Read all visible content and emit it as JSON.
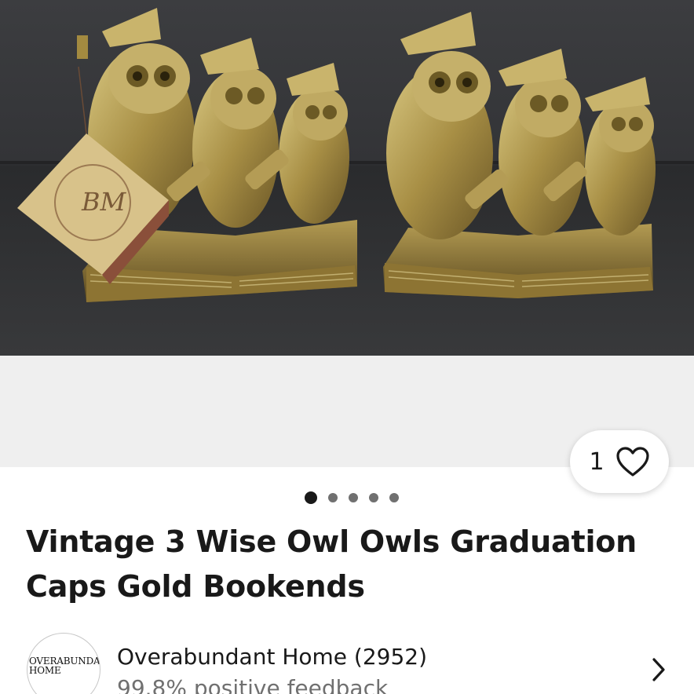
{
  "listing": {
    "title": "Vintage 3 Wise Owl Owls Graduation Caps Gold Bookends",
    "photo_alt": "Brass owl bookends with graduation caps",
    "like_count": "1",
    "photo_index": 1,
    "photo_total": 5
  },
  "seller": {
    "name": "Overabundant Home (2952)",
    "feedback": "99.8% positive feedback",
    "avatar_text": "OVERABUNDANT\nHOME"
  },
  "icons": {
    "like": "heart-outline-icon",
    "seller_link": "chevron-right-icon"
  },
  "colors": {
    "text_primary": "#191919",
    "text_secondary": "#707070",
    "photo_backdrop": "#efefef",
    "dot_active": "#191919",
    "dot_inactive": "#707070"
  }
}
